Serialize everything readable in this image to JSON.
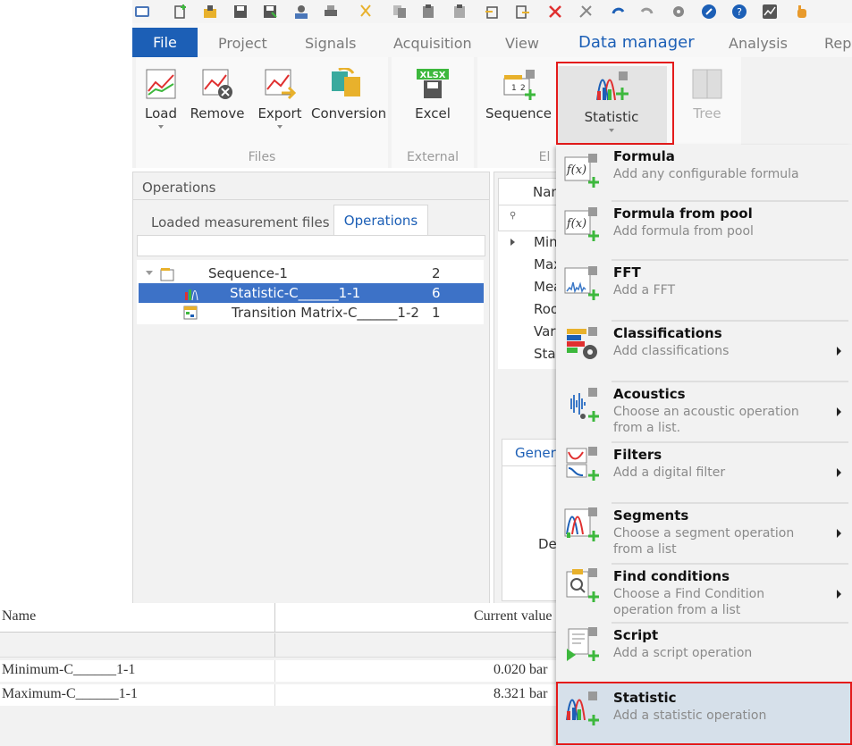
{
  "quick_access_icons": [
    "app-icon",
    "new-icon",
    "open-icon",
    "save-icon",
    "save-as-icon",
    "auto-icon",
    "print-icon",
    "cut-icon",
    "copy-icon",
    "paste-icon",
    "paste-special-icon",
    "import-icon",
    "export-icon",
    "delete-icon",
    "tools-icon",
    "undo-icon",
    "redo-icon",
    "settings-icon",
    "wrench-icon",
    "help-icon",
    "chart-icon",
    "hand-icon"
  ],
  "tabs": {
    "file": "File",
    "project": "Project",
    "signals": "Signals",
    "acquisition": "Acquisition",
    "view": "View",
    "data_manager": "Data manager",
    "analysis": "Analysis",
    "rep": "Rep"
  },
  "ribbon": {
    "files": {
      "load": "Load",
      "remove": "Remove",
      "export": "Export",
      "conversion": "Conversion",
      "group": "Files"
    },
    "external": {
      "excel": "Excel",
      "badge": "XLSX",
      "group": "External"
    },
    "elements": {
      "sequence": "Sequence",
      "statistic": "Statistic",
      "tree": "Tree",
      "group": "El"
    }
  },
  "operations_panel": {
    "title": "Operations",
    "tab_loaded": "Loaded measurement files",
    "tab_operations": "Operations",
    "tree": [
      {
        "name": "Sequence-1",
        "count": "2"
      },
      {
        "name": "Statistic-C______1-1",
        "count": "6"
      },
      {
        "name": "Transition Matrix-C______1-2",
        "count": "1"
      }
    ]
  },
  "mid_panel": {
    "header": "Nan",
    "rows": [
      "Min",
      "Max",
      "Mea",
      "Roo",
      "Var",
      "Sta"
    ],
    "tab_general": "Genera",
    "field_label": "De"
  },
  "bottom_table": {
    "headers": {
      "name": "Name",
      "current_value": "Current value"
    },
    "rows": [
      {
        "name": "Minimum-C______1-1",
        "value": "0.020 bar"
      },
      {
        "name": "Maximum-C______1-1",
        "value": "8.321 bar"
      }
    ]
  },
  "menu": [
    {
      "title": "Formula",
      "subtitle": "Add any configurable formula",
      "submenu": false
    },
    {
      "title": "Formula from pool",
      "subtitle": "Add formula from pool",
      "submenu": false
    },
    {
      "title": "FFT",
      "subtitle": "Add a FFT",
      "submenu": false
    },
    {
      "title": "Classifications",
      "subtitle": "Add classifications",
      "submenu": true
    },
    {
      "title": "Acoustics",
      "subtitle": "Choose an acoustic operation from a list.",
      "submenu": true
    },
    {
      "title": "Filters",
      "subtitle": "Add a digital filter",
      "submenu": true
    },
    {
      "title": "Segments",
      "subtitle": "Choose a segment operation from a list",
      "submenu": true
    },
    {
      "title": "Find conditions",
      "subtitle": "Choose a Find Condition operation from a list",
      "submenu": true
    },
    {
      "title": "Script",
      "subtitle": "Add a script operation",
      "submenu": false
    },
    {
      "title": "Statistic",
      "subtitle": "Add a statistic operation",
      "submenu": false
    }
  ],
  "colors": {
    "accent": "#1c5fb6",
    "highlight": "#3d72c7",
    "annotation": "#e41b1b",
    "add_green": "#3db83d"
  }
}
